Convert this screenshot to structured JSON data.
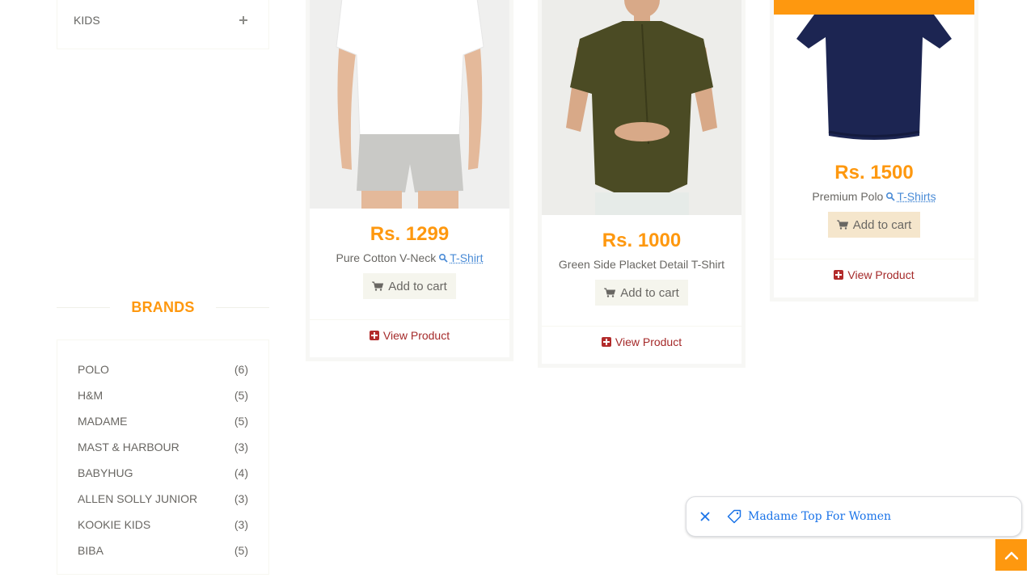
{
  "sidebar": {
    "category": {
      "label": "KIDS",
      "expand_icon": "plus-icon"
    },
    "brands_title": "BRANDS",
    "brands": [
      {
        "name": "POLO",
        "count": "(6)"
      },
      {
        "name": "H&M",
        "count": "(5)"
      },
      {
        "name": "MADAME",
        "count": "(5)"
      },
      {
        "name": "MAST & HARBOUR",
        "count": "(3)"
      },
      {
        "name": "BABYHUG",
        "count": "(4)"
      },
      {
        "name": "ALLEN SOLLY JUNIOR",
        "count": "(3)"
      },
      {
        "name": "KOOKIE KIDS",
        "count": "(3)"
      },
      {
        "name": "BIBA",
        "count": "(5)"
      }
    ]
  },
  "products": [
    {
      "price": "Rs. 1299",
      "name": "Pure Cotton V-Neck",
      "category": "T-Shirt",
      "add_label": "Add to cart",
      "view_label": "View Product"
    },
    {
      "price": "Rs. 1000",
      "name": "Green Side Placket Detail T-Shirt",
      "category": "",
      "add_label": "Add to cart",
      "view_label": "View Product"
    },
    {
      "price": "Rs. 1500",
      "name": "Premium Polo",
      "category": "T-Shirts",
      "add_label": "Add to cart",
      "view_label": "View Product"
    }
  ],
  "toast": {
    "text": "Madame Top For Women"
  },
  "colors": {
    "accent": "#fe980f",
    "link": "#1a73e8",
    "view": "#a52a2a"
  }
}
